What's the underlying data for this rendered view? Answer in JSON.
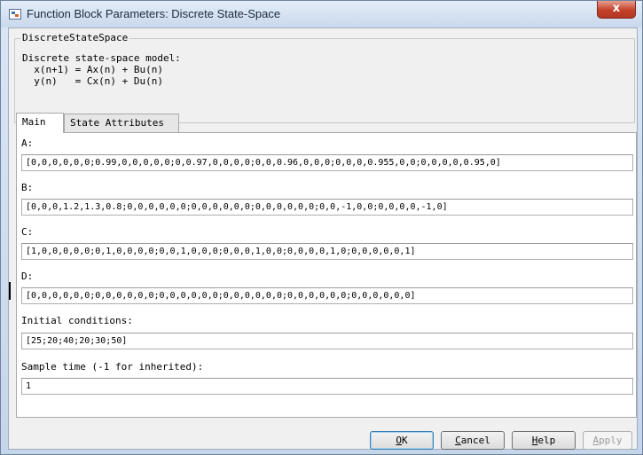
{
  "window": {
    "title": "Function Block Parameters: Discrete State-Space",
    "close_label": "x"
  },
  "group": {
    "legend": "DiscreteStateSpace",
    "description": [
      "Discrete state-space model:",
      "  x(n+1) = Ax(n) + Bu(n)",
      "  y(n)   = Cx(n) + Du(n)"
    ]
  },
  "tabs": [
    {
      "label": "Main",
      "active": true
    },
    {
      "label": "State Attributes",
      "active": false
    }
  ],
  "params": {
    "a": {
      "label": "A:",
      "value": "[0,0,0,0,0,0;0.99,0,0,0,0,0;0,0.97,0,0,0,0;0,0,0.96,0,0,0;0,0,0,0.955,0,0;0,0,0,0,0.95,0]"
    },
    "b": {
      "label": "B:",
      "value": "[0,0,0,1.2,1.3,0.8;0,0,0,0,0,0;0,0,0,0,0,0;0,0,0,0,0,0;0,0,-1,0,0;0,0,0,0,-1,0]"
    },
    "c": {
      "label": "C:",
      "value": "[1,0,0,0,0,0;0,1,0,0,0,0;0,0,1,0,0,0;0,0,0,1,0,0;0,0,0,0,1,0;0,0,0,0,0,1]"
    },
    "d": {
      "label": "D:",
      "value": "[0,0,0,0,0,0;0,0,0,0,0,0;0,0,0,0,0,0;0,0,0,0,0,0;0,0,0,0,0,0;0,0,0,0,0,0]"
    },
    "initial": {
      "label": "Initial conditions:",
      "value": "[25;20;40;20;30;50]"
    },
    "sample": {
      "label": "Sample time (-1 for inherited):",
      "value": "1"
    }
  },
  "buttons": {
    "ok": {
      "mnemonic": "O",
      "rest": "K"
    },
    "cancel": {
      "mnemonic": "C",
      "rest": "ancel"
    },
    "help": {
      "mnemonic": "H",
      "rest": "elp"
    },
    "apply": {
      "mnemonic": "A",
      "rest": "pply",
      "enabled": false
    }
  },
  "colors": {
    "close_button": "#c4402a",
    "default_button_border": "#3c7fb1",
    "disabled_text": "#9a9a9a"
  }
}
